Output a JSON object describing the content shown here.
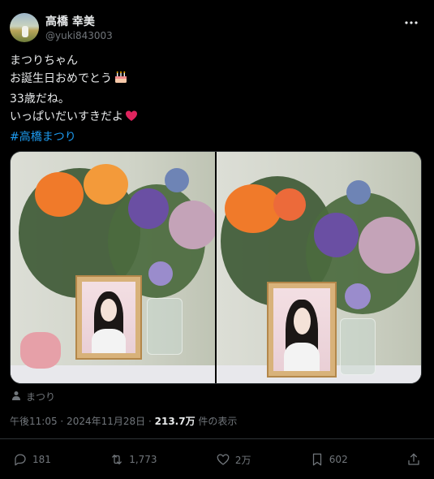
{
  "author": {
    "display_name": "高橋 幸美",
    "handle": "@yuki843003"
  },
  "tweet": {
    "lines": [
      "まつりちゃん",
      "お誕生日おめでとう",
      "33歳だね。",
      "いっぱいだいすきだよ"
    ],
    "hashtag": "#高橋まつり"
  },
  "media_tag": "まつり",
  "meta": {
    "time": "午後11:05",
    "date": "2024年11月28日",
    "views": "213.7万",
    "views_label": "件の表示"
  },
  "actions": {
    "replies": "181",
    "reposts": "1,773",
    "likes": "2万",
    "bookmarks": "602"
  },
  "colors": {
    "background": "#000000",
    "text": "#e7e9ea",
    "secondary": "#71767b",
    "link": "#1d9bf0",
    "heart_emoji": "#e0245e"
  }
}
